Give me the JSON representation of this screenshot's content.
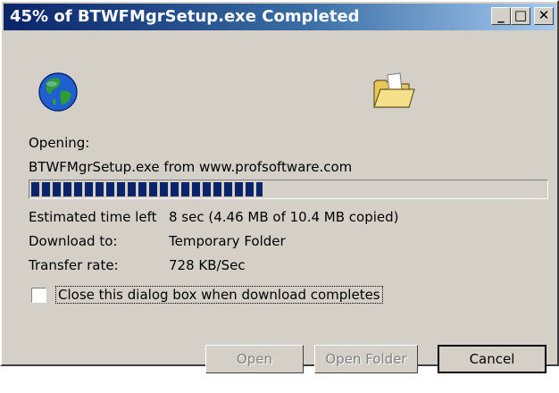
{
  "window": {
    "title": "45% of BTWFMgrSetup.exe Completed",
    "controls": {
      "minimize": "_",
      "maximize": "□",
      "close": "✕"
    }
  },
  "icons": {
    "globe": "globe-icon",
    "folder": "open-folder-icon"
  },
  "status": {
    "opening_label": "Opening:",
    "file_source": "BTWFMgrSetup.exe from www.profsoftware.com"
  },
  "progress": {
    "percent": 45,
    "fill_color": "#0a246a"
  },
  "details": {
    "time_left_label": "Estimated time left",
    "time_left_value": "8 sec (4.46 MB of 10.4 MB copied)",
    "download_to_label": "Download to:",
    "download_to_value": "Temporary Folder",
    "transfer_rate_label": "Transfer rate:",
    "transfer_rate_value": "728 KB/Sec"
  },
  "options": {
    "close_on_complete_label": "Close this dialog box when download completes",
    "close_on_complete_checked": false
  },
  "buttons": {
    "open": "Open",
    "open_folder": "Open Folder",
    "cancel": "Cancel"
  },
  "colors": {
    "title_bar": "#0a246a",
    "dialog_face": "#d4d0c8"
  }
}
